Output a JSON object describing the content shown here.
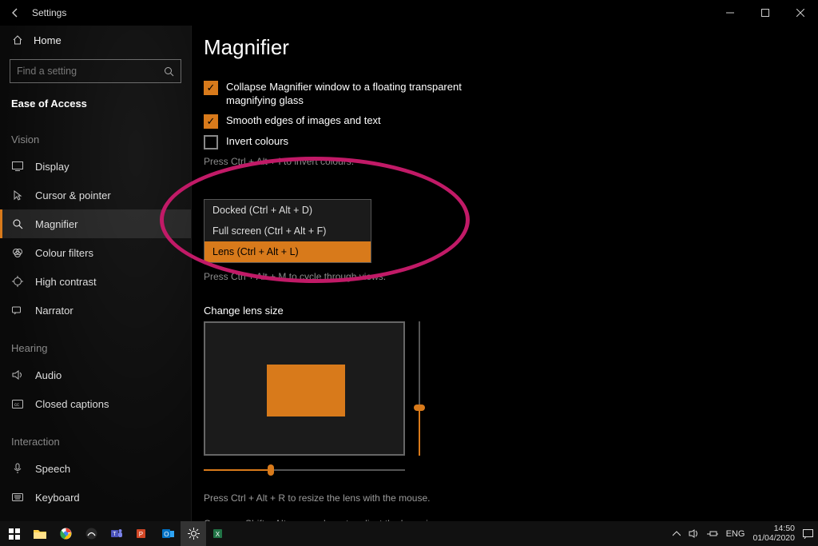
{
  "titlebar": {
    "title": "Settings"
  },
  "home_label": "Home",
  "search": {
    "placeholder": "Find a setting"
  },
  "group_caption": "Ease of Access",
  "groups": {
    "vision": {
      "caption": "Vision",
      "items": [
        "Display",
        "Cursor & pointer",
        "Magnifier",
        "Colour filters",
        "High contrast",
        "Narrator"
      ]
    },
    "hearing": {
      "caption": "Hearing",
      "items": [
        "Audio",
        "Closed captions"
      ]
    },
    "interaction": {
      "caption": "Interaction",
      "items": [
        "Speech",
        "Keyboard"
      ]
    }
  },
  "page": {
    "heading": "Magnifier",
    "chk_collapse": "Collapse Magnifier window to a floating transparent magnifying glass",
    "chk_smooth": "Smooth edges of images and text",
    "chk_invert": "Invert colours",
    "invert_hint": "Press Ctrl + Alt + I to invert colours.",
    "view_options": {
      "docked": "Docked (Ctrl + Alt + D)",
      "full": "Full screen (Ctrl + Alt + F)",
      "lens": "Lens (Ctrl + Alt + L)"
    },
    "view_hint": "Press Ctrl + Alt + M to cycle through views.",
    "lens_caption": "Change lens size",
    "lens_hint1": "Press Ctrl + Alt + R to resize the lens with the mouse.",
    "lens_hint2": "Or, press Shift + Alt + arrow keys to adjust the lens size."
  },
  "tray": {
    "lang": "ENG",
    "time": "14:50",
    "date": "01/04/2020"
  }
}
